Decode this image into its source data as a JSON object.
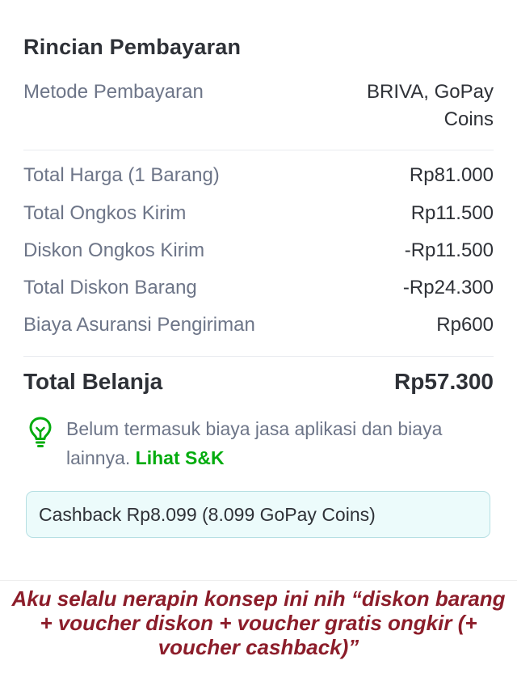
{
  "header": {
    "title": "Rincian Pembayaran"
  },
  "payment_method": {
    "label": "Metode Pembayaran",
    "value_line1": "BRIVA, GoPay",
    "value_line2": "Coins"
  },
  "items": [
    {
      "label": "Total Harga (1 Barang)",
      "value": "Rp81.000"
    },
    {
      "label": "Total Ongkos Kirim",
      "value": "Rp11.500"
    },
    {
      "label": "Diskon Ongkos Kirim",
      "value": "-Rp11.500"
    },
    {
      "label": "Total Diskon Barang",
      "value": "-Rp24.300"
    },
    {
      "label": "Biaya Asuransi Pengiriman",
      "value": "Rp600"
    }
  ],
  "total": {
    "label": "Total Belanja",
    "value": "Rp57.300"
  },
  "info": {
    "icon": "lightbulb-icon",
    "text": "Belum termasuk biaya jasa aplikasi dan biaya lainnya. ",
    "link_label": "Lihat S&K"
  },
  "cashback": {
    "text": "Cashback Rp8.099 (8.099 GoPay Coins)"
  },
  "caption": {
    "text": "Aku selalu nerapin konsep ini nih “diskon barang + voucher diskon + voucher gratis ongkir (+ voucher cashback)”"
  },
  "colors": {
    "accent_green": "#03ac0e",
    "caption_red": "#8c1d2a",
    "cashback_bg": "#ecfbfb",
    "cashback_border": "#b6dfe3"
  }
}
